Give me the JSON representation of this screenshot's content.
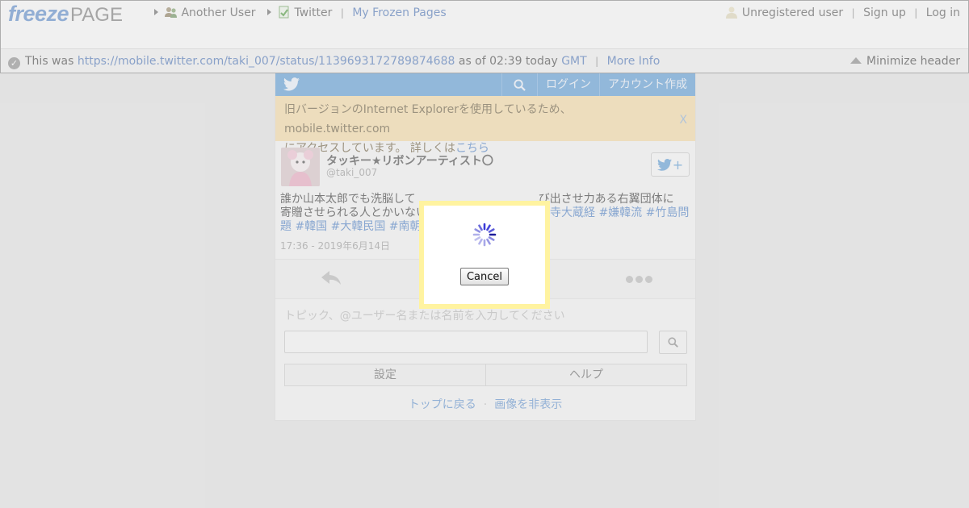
{
  "header": {
    "logo": {
      "freeze": "freeze",
      "page": "PAGE"
    },
    "breadcrumbs": {
      "another_user": "Another User",
      "twitter": "Twitter",
      "sep": "|",
      "my_frozen_pages": "My Frozen Pages"
    },
    "user_menu": {
      "status": "Unregistered user",
      "sign_up": "Sign up",
      "log_in": "Log in",
      "sep": "|"
    },
    "snapshot": {
      "prefix": "This was",
      "url": "https://mobile.twitter.com/taki_007/status/1139693172789874688",
      "as_of": "as of 02:39 today",
      "tz": "GMT",
      "sep": "|",
      "more_info": "More Info"
    },
    "minimize": "Minimize header"
  },
  "twitter": {
    "nav": {
      "login": "ログイン",
      "signup": "アカウント作成"
    },
    "notice": {
      "line1": "旧バージョンのInternet Explorerを使用しているため、mobile.twitter.com",
      "line2": "にアクセスしています。 詳しくは",
      "link": "こちら",
      "close": "X"
    },
    "tweet": {
      "name": "タッキー★リボンアーティスト〇",
      "handle": "@taki_007",
      "text_line1": "誰か山本太郎でも洗脳して",
      "text_line1_tail": "び出させ力ある右翼団体に",
      "text_line2": "寄贈させられる人とかいない",
      "tags_line2": "寺大蔵経 #嫌韓流 #竹島問",
      "tags_line3": "題 #韓国 #大韓民国 #南朝鮮",
      "time": "17:36 - 2019年6月14日"
    },
    "search": {
      "placeholder": "トピック、@ユーザー名または名前を入力してください"
    },
    "links": {
      "settings": "設定",
      "help": "ヘルプ"
    },
    "footer": {
      "top": "トップに戻る",
      "dot": "·",
      "hide_images": "画像を非表示"
    }
  },
  "dialog": {
    "cancel": "Cancel"
  },
  "colors": {
    "twitter_blue": "#5b9bd6",
    "notice_bg": "#f6dba4",
    "dialog_border": "#fff3a0",
    "link_blue": "#4a74b8"
  }
}
